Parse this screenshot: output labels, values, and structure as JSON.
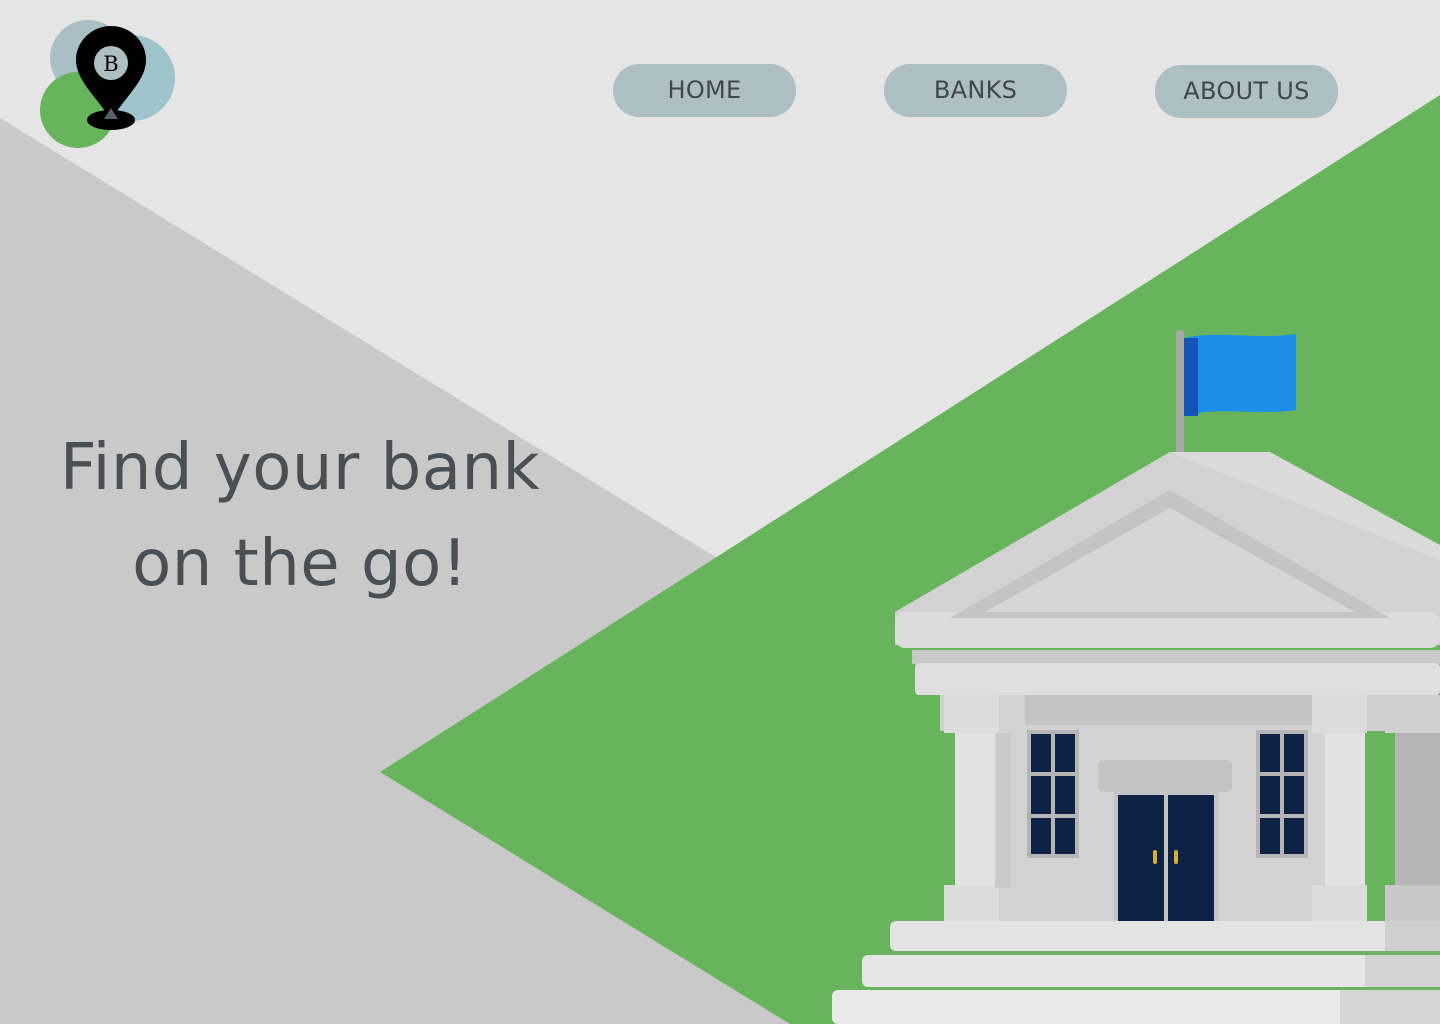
{
  "logo": {
    "letter": "B",
    "icon": "map-pin-icon",
    "colors": {
      "pin": "#000000",
      "blue_circle": "#9fc3cb",
      "green_circle": "#68b45c",
      "inner_circle": "#aebfc3"
    }
  },
  "nav": {
    "home": "HOME",
    "banks": "BANKS",
    "about": "ABOUT US"
  },
  "hero": {
    "line1": "Find your bank",
    "line2": "on the go!"
  },
  "illustration": {
    "name": "bank-building-illustration",
    "flag_color": "#1e8fe8"
  },
  "colors": {
    "background": "#e5e5e5",
    "left_band": "#c9c9c9",
    "green": "#68b45c",
    "nav_button": "#aebfc3",
    "text": "#4a4f53",
    "door": "#0d2245"
  }
}
